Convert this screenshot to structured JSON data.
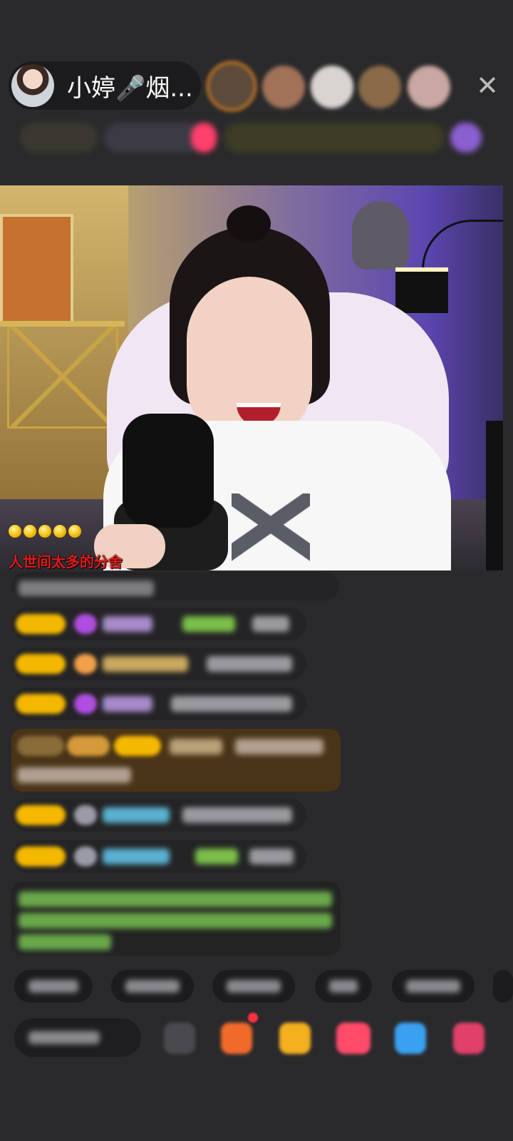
{
  "header": {
    "host_name": "小婷🎤烟...",
    "close_icon": "✕"
  },
  "video": {
    "caption": "人世间太多的分舍",
    "fan_level_dots": 5
  },
  "colors": {
    "background": "#2a2a2c",
    "gold_badge": "#f5b800",
    "purple_gem": "#b04ee0",
    "notice_green": "#7bbf4a",
    "caption_red": "#e21a1a"
  },
  "icons": [
    "avatar",
    "close-icon",
    "fan-badge-dots",
    "gift-box-icon",
    "shop-icon",
    "heart-gift-icon",
    "game-controller-icon",
    "more-gifts-icon"
  ]
}
